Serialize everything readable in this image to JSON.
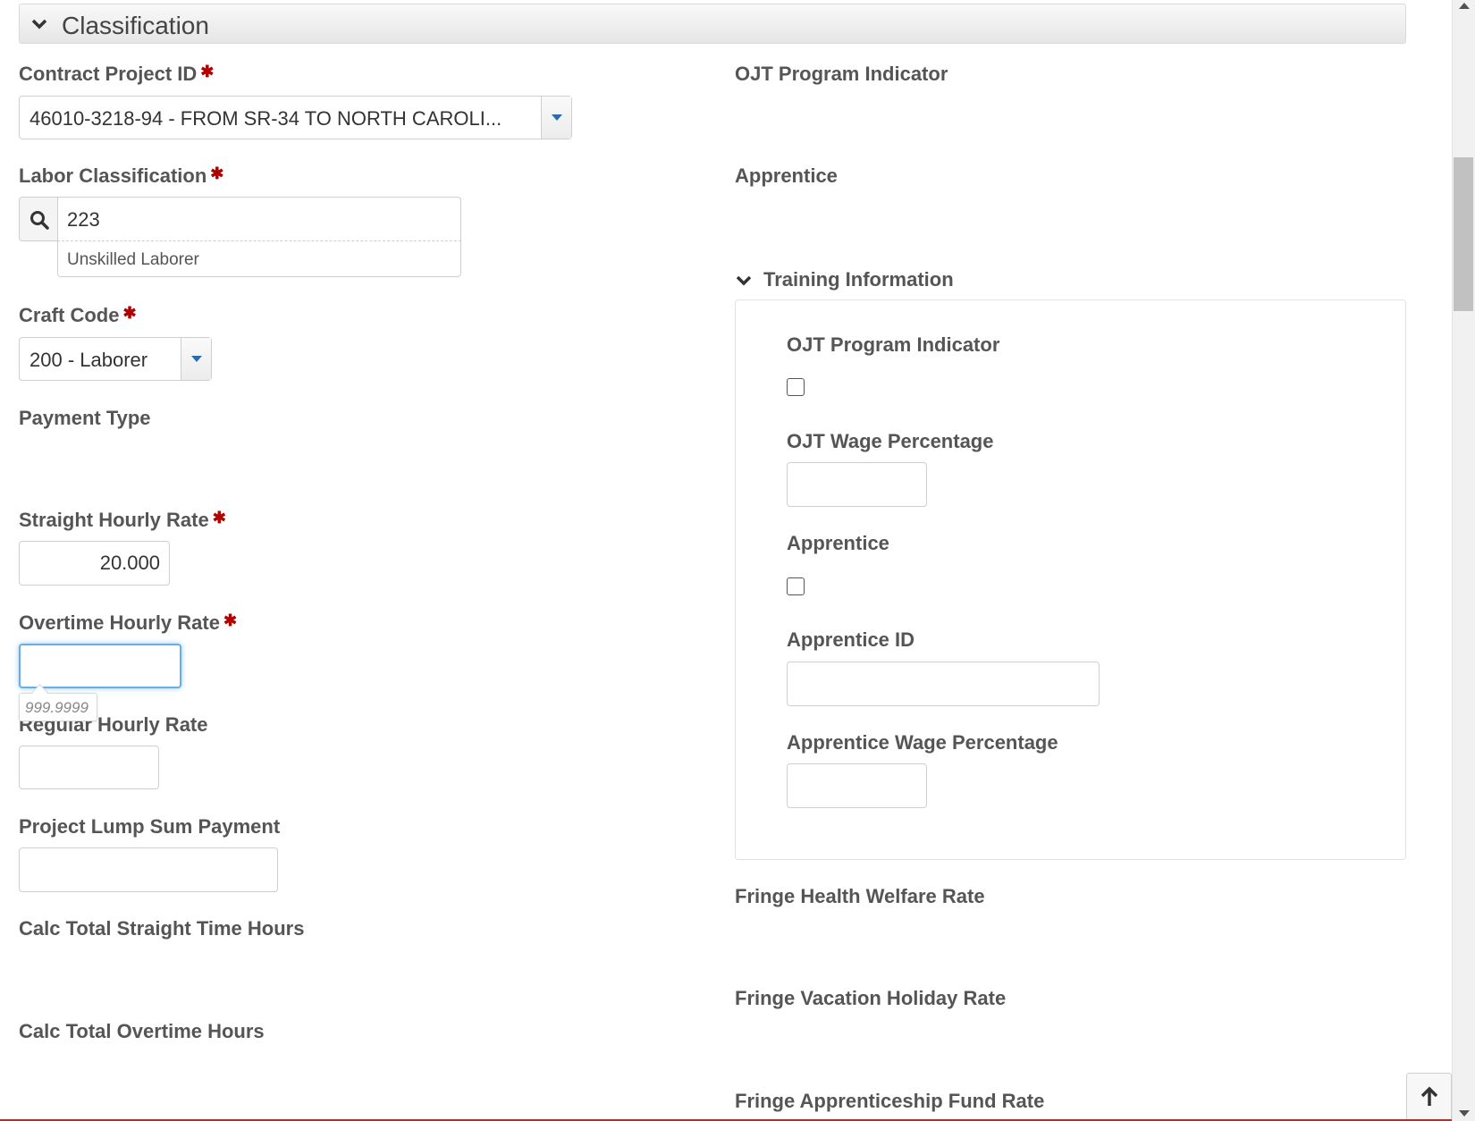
{
  "section": {
    "title": "Classification"
  },
  "left": {
    "contract_project": {
      "label": "Contract Project ID",
      "value": "46010-3218-94 - FROM SR-34 TO NORTH CAROLI..."
    },
    "labor_classification": {
      "label": "Labor Classification",
      "value": "223",
      "suggestion": "Unskilled Laborer"
    },
    "craft_code": {
      "label": "Craft Code",
      "value": "200 - Laborer"
    },
    "payment_type": {
      "label": "Payment Type"
    },
    "straight_rate": {
      "label": "Straight Hourly Rate",
      "value": "20.000"
    },
    "overtime_rate": {
      "label": "Overtime Hourly Rate",
      "value": "",
      "tooltip": "999.9999"
    },
    "regular_rate": {
      "label": "Regular Hourly Rate",
      "value": ""
    },
    "lump_sum": {
      "label": "Project Lump Sum Payment",
      "value": ""
    },
    "calc_straight": {
      "label": "Calc Total Straight Time Hours"
    },
    "calc_overtime": {
      "label": "Calc Total Overtime Hours"
    }
  },
  "right": {
    "ojt_indicator": {
      "label": "OJT Program Indicator"
    },
    "apprentice": {
      "label": "Apprentice"
    },
    "training": {
      "title": "Training Information",
      "ojt_indicator_label": "OJT Program Indicator",
      "ojt_wage_label": "OJT Wage Percentage",
      "apprentice_label": "Apprentice",
      "apprentice_id_label": "Apprentice ID",
      "apprentice_wage_label": "Apprentice Wage Percentage"
    },
    "fringe_health": {
      "label": "Fringe Health Welfare Rate"
    },
    "fringe_vacation": {
      "label": "Fringe Vacation Holiday Rate"
    },
    "fringe_apprenticeship": {
      "label": "Fringe Apprenticeship Fund Rate"
    }
  },
  "colors": {
    "required": "#b00000",
    "accent": "#2b6cb0",
    "focus": "#66afe9"
  },
  "icons": {
    "collapse": "chevron-down-icon",
    "search": "search-icon",
    "dropdown": "caret-down-icon",
    "back_to_top": "arrow-up-icon"
  }
}
